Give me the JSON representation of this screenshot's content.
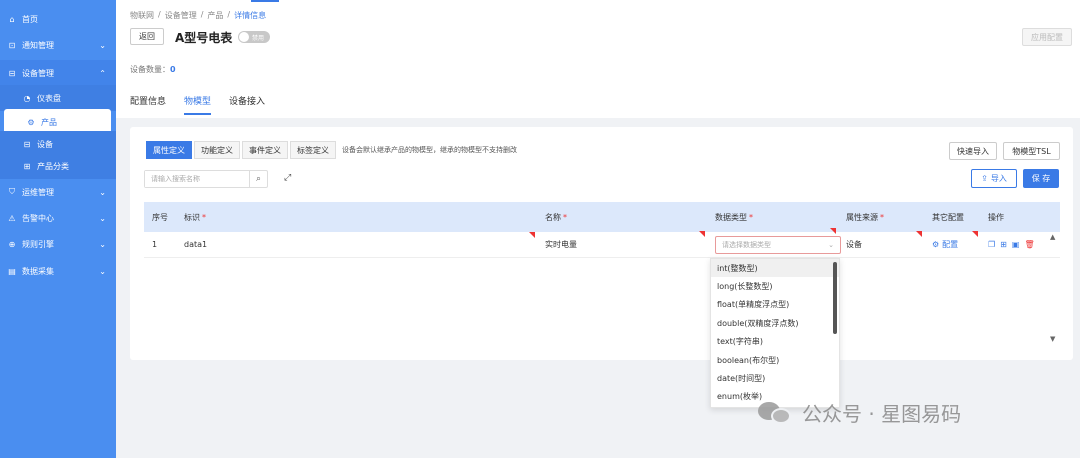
{
  "sidebar": {
    "items": [
      {
        "icon": "home-icon",
        "glyph": "⌂",
        "label": "首页"
      },
      {
        "icon": "bell-icon",
        "glyph": "⊡",
        "label": "通知管理"
      },
      {
        "icon": "device-icon",
        "glyph": "⊟",
        "label": "设备管理"
      },
      {
        "icon": "dashboard-icon",
        "glyph": "◔",
        "label": "仪表盘"
      },
      {
        "icon": "product-icon",
        "glyph": "⚙",
        "label": "产品"
      },
      {
        "icon": "device-sub-icon",
        "glyph": "⊟",
        "label": "设备"
      },
      {
        "icon": "category-icon",
        "glyph": "⊞",
        "label": "产品分类"
      },
      {
        "icon": "shield-icon",
        "glyph": "⛉",
        "label": "运维管理"
      },
      {
        "icon": "alarm-icon",
        "glyph": "⚠",
        "label": "告警中心"
      },
      {
        "icon": "rule-icon",
        "glyph": "⊕",
        "label": "规则引擎"
      },
      {
        "icon": "data-icon",
        "glyph": "▤",
        "label": "数据采集"
      }
    ]
  },
  "header": {
    "breadcrumb": [
      "物联网",
      "设备管理",
      "产品",
      "详情信息"
    ],
    "back_label": "返回",
    "title": "A型号电表",
    "toggle_label": "禁用",
    "apply_label": "应用配置",
    "device_count_label": "设备数量：",
    "device_count": "0",
    "tabs": [
      "配置信息",
      "物模型",
      "设备接入"
    ]
  },
  "model": {
    "sub_tabs": [
      "属性定义",
      "功能定义",
      "事件定义",
      "标签定义"
    ],
    "sub_tab_note": "设备会默认继承产品的物模型，继承的物模型不支持删改",
    "quick_import_label": "快速导入",
    "tsl_label": "物模型TSL",
    "search_placeholder": "请输入搜索名称",
    "import_label": "导入",
    "save_label": "保 存"
  },
  "table": {
    "headers": [
      "序号",
      "标识",
      "名称",
      "数据类型",
      "属性来源",
      "其它配置",
      "操作"
    ],
    "rows": [
      {
        "index": "1",
        "id": "data1",
        "name": "实时电量",
        "type_placeholder": "请选择数据类型",
        "source": "设备",
        "config": "配置"
      }
    ]
  },
  "dropdown": {
    "options": [
      "int(整数型)",
      "long(长整数型)",
      "float(单精度浮点型)",
      "double(双精度浮点数)",
      "text(字符串)",
      "boolean(布尔型)",
      "date(时间型)",
      "enum(枚举)"
    ]
  },
  "watermark": {
    "text": "公众号 · 星图易码"
  },
  "colors": {
    "sidebar": "#4a8ef0",
    "accent": "#3a7ae6",
    "required": "#e33333"
  }
}
